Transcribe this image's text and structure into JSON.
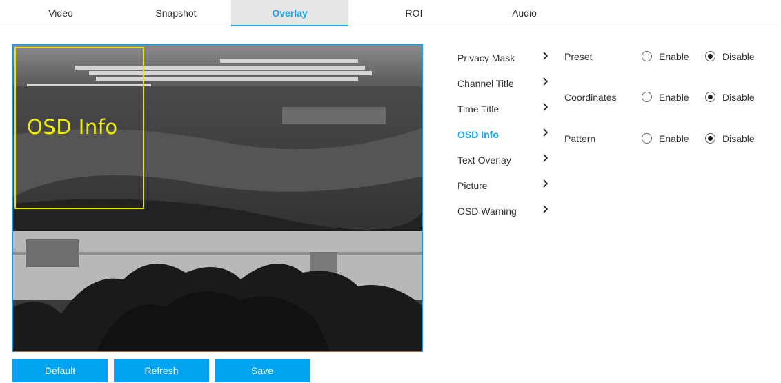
{
  "tabs": [
    {
      "label": "Video"
    },
    {
      "label": "Snapshot"
    },
    {
      "label": "Overlay"
    },
    {
      "label": "ROI"
    },
    {
      "label": "Audio"
    }
  ],
  "active_tab": "Overlay",
  "preview": {
    "osd_label": "OSD Info"
  },
  "buttons": {
    "default_label": "Default",
    "refresh_label": "Refresh",
    "save_label": "Save"
  },
  "submenu": [
    {
      "label": "Privacy Mask"
    },
    {
      "label": "Channel Title"
    },
    {
      "label": "Time Title"
    },
    {
      "label": "OSD Info"
    },
    {
      "label": "Text Overlay"
    },
    {
      "label": "Picture"
    },
    {
      "label": "OSD Warning"
    }
  ],
  "active_submenu": "OSD Info",
  "settings": [
    {
      "name": "Preset",
      "options": [
        "Enable",
        "Disable"
      ],
      "selected": "Disable"
    },
    {
      "name": "Coordinates",
      "options": [
        "Enable",
        "Disable"
      ],
      "selected": "Disable"
    },
    {
      "name": "Pattern",
      "options": [
        "Enable",
        "Disable"
      ],
      "selected": "Disable"
    }
  ],
  "colors": {
    "accent": "#1aa3e8",
    "button": "#00a3f0",
    "osd": "#e6e600"
  }
}
